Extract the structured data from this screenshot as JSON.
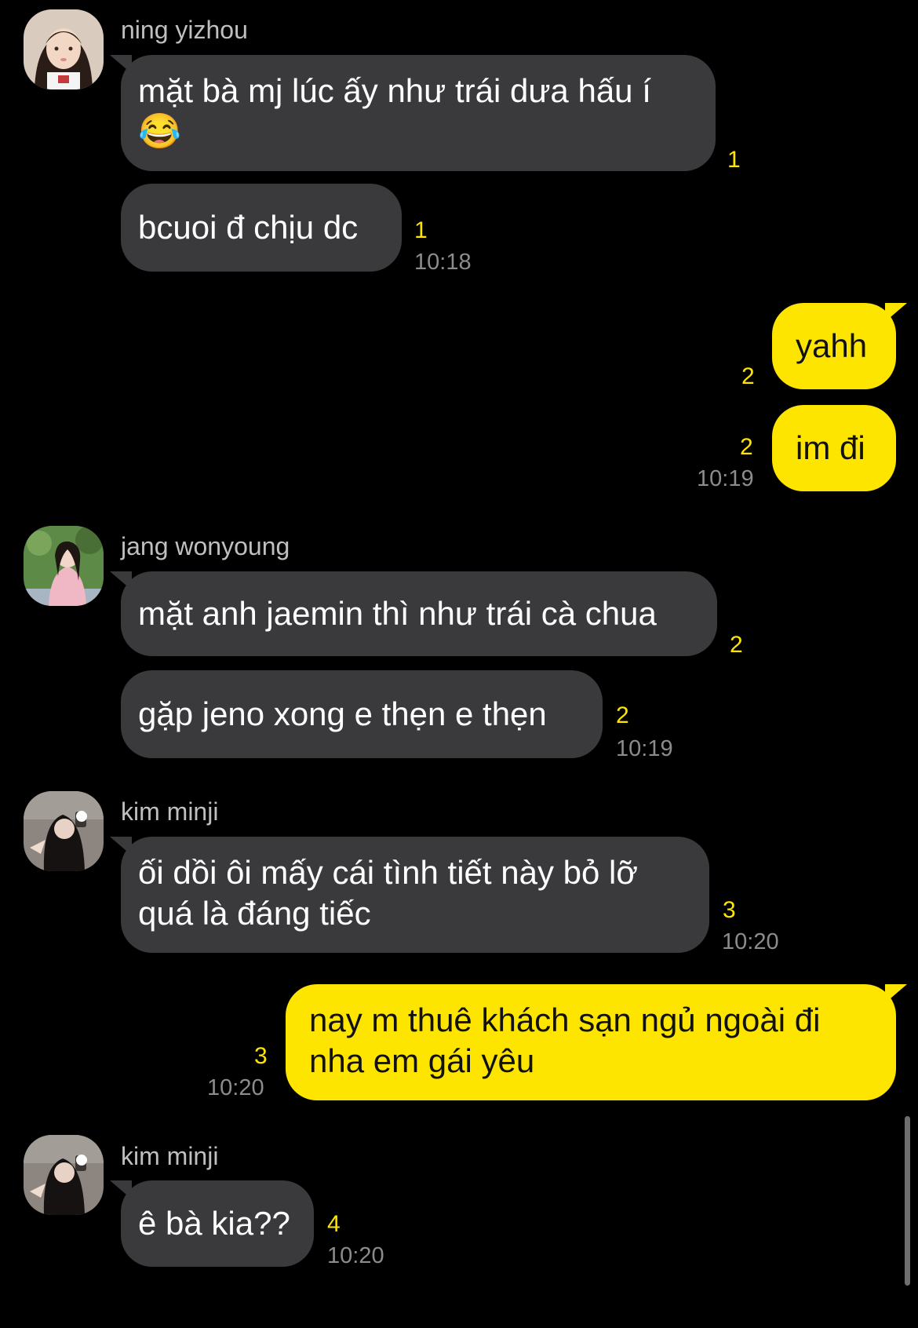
{
  "messages": [
    {
      "sender": "ning yizhou",
      "text": "mặt bà mj lúc ấy như trái dưa hấu í",
      "emoji": "😂",
      "unread": "1"
    },
    {
      "text": "bcuoi đ chịu dc",
      "unread": "1",
      "time": "10:18"
    },
    {
      "text": "yahh",
      "unread": "2"
    },
    {
      "text": "im đi",
      "unread": "2",
      "time": "10:19"
    },
    {
      "sender": "jang wonyoung",
      "text": "mặt anh jaemin thì như trái cà chua",
      "unread": "2"
    },
    {
      "text": "gặp jeno xong e thẹn e thẹn",
      "unread": "2",
      "time": "10:19"
    },
    {
      "sender": "kim minji",
      "text_lines": [
        "ối dồi ôi mấy cái tình tiết này bỏ lỡ",
        "quá là đáng tiếc"
      ],
      "unread": "3",
      "time": "10:20"
    },
    {
      "text_lines": [
        "nay m thuê khách sạn ngủ ngoài đi",
        "nha em gái yêu"
      ],
      "unread": "3",
      "time": "10:20"
    },
    {
      "sender": "kim minji",
      "text": "ê bà kia??",
      "unread": "4",
      "time": "10:20"
    }
  ],
  "colors": {
    "background": "#000000",
    "incoming_bubble": "#3a3a3c",
    "outgoing_bubble": "#fee500",
    "unread_count": "#fee500",
    "timestamp": "#8c8c8c"
  }
}
